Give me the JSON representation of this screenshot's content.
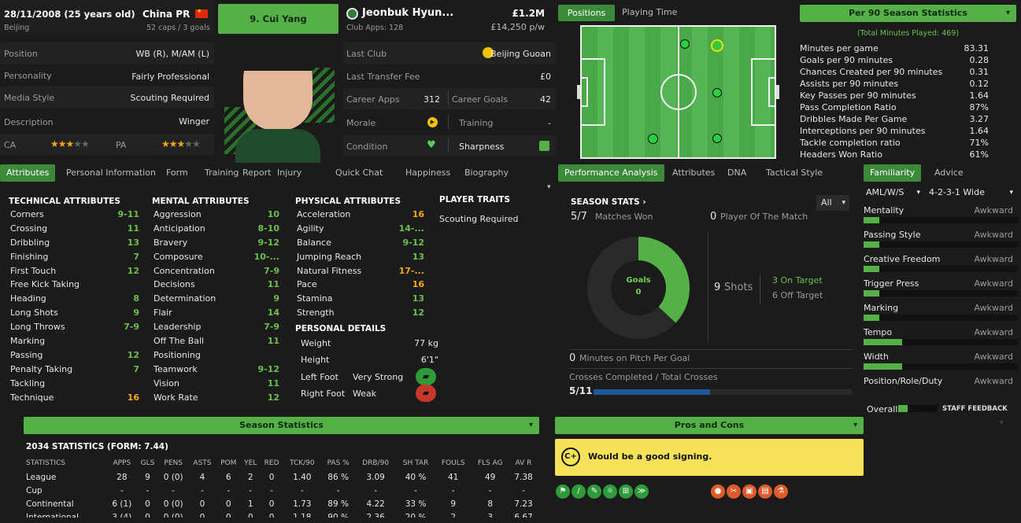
{
  "profile": {
    "dob": "28/11/2008 (25 years old)",
    "nation": "China PR",
    "city": "Beijing",
    "caps": "52 caps / 3 goals",
    "name_button": "9. Cui Yang"
  },
  "club": {
    "name": "Jeonbuk Hyun...",
    "apps": "Club Apps: 128",
    "value": "£1.2M",
    "wage": "£14,250 p/w"
  },
  "info_left": [
    {
      "label": "Position",
      "value": "WB (R), M/AM (L)"
    },
    {
      "label": "Personality",
      "value": "Fairly Professional"
    },
    {
      "label": "Media Style",
      "value": "Scouting Required"
    },
    {
      "label": "Description",
      "value": "Winger"
    }
  ],
  "ratings": {
    "ca_label": "CA",
    "pa_label": "PA",
    "ca_stars": "★★★★★",
    "pa_stars": "★★★★★"
  },
  "info_right": {
    "last_club_label": "Last Club",
    "last_club": "Beijing Guoan",
    "transfer_label": "Last Transfer Fee",
    "transfer": "£0",
    "career_apps_label": "Career Apps",
    "career_apps": "312",
    "career_goals_label": "Career Goals",
    "career_goals": "42",
    "morale_label": "Morale",
    "training_label": "Training",
    "training": "-",
    "condition_label": "Condition",
    "sharpness_label": "Sharpness"
  },
  "pitch_tabs": {
    "positions": "Positions",
    "playing_time": "Playing Time"
  },
  "per90": {
    "title": "Per 90 Season Statistics",
    "sub": "(Total Minutes Played: 469)",
    "rows": [
      {
        "label": "Minutes per game",
        "value": "83.31"
      },
      {
        "label": "Goals per 90 minutes",
        "value": "0.28"
      },
      {
        "label": "Chances Created per 90 minutes",
        "value": "0.31"
      },
      {
        "label": "Assists per 90 minutes",
        "value": "0.12"
      },
      {
        "label": "Key Passes per 90 minutes",
        "value": "1.64"
      },
      {
        "label": "Pass Completion Ratio",
        "value": "87%"
      },
      {
        "label": "Dribbles Made Per Game",
        "value": "3.27"
      },
      {
        "label": "Interceptions per 90 minutes",
        "value": "1.64"
      },
      {
        "label": "Tackle completion ratio",
        "value": "71%"
      },
      {
        "label": "Headers Won Ratio",
        "value": "61%"
      }
    ]
  },
  "tabs_left": [
    "Attributes",
    "Personal Information",
    "Form",
    "Training",
    "Report",
    "Injury",
    "Quick Chat",
    "Happiness",
    "Biography"
  ],
  "tabs_mid": [
    "Performance Analysis",
    "Attributes",
    "DNA",
    "Tactical Style"
  ],
  "tabs_right": [
    "Familiarity",
    "Advice"
  ],
  "technical": {
    "title": "TECHNICAL ATTRIBUTES",
    "rows": [
      {
        "n": "Corners",
        "v": "9-11",
        "c": "green"
      },
      {
        "n": "Crossing",
        "v": "11",
        "c": "green"
      },
      {
        "n": "Dribbling",
        "v": "13",
        "c": "green"
      },
      {
        "n": "Finishing",
        "v": "7",
        "c": "green"
      },
      {
        "n": "First Touch",
        "v": "12",
        "c": "green"
      },
      {
        "n": "Free Kick Taking",
        "v": "",
        "c": "green"
      },
      {
        "n": "Heading",
        "v": "8",
        "c": "green"
      },
      {
        "n": "Long Shots",
        "v": "9",
        "c": "green"
      },
      {
        "n": "Long Throws",
        "v": "7-9",
        "c": "green"
      },
      {
        "n": "Marking",
        "v": "",
        "c": "green"
      },
      {
        "n": "Passing",
        "v": "12",
        "c": "green"
      },
      {
        "n": "Penalty Taking",
        "v": "7",
        "c": "green"
      },
      {
        "n": "Tackling",
        "v": "",
        "c": "green"
      },
      {
        "n": "Technique",
        "v": "16",
        "c": "orange"
      }
    ]
  },
  "mental": {
    "title": "MENTAL ATTRIBUTES",
    "rows": [
      {
        "n": "Aggression",
        "v": "10",
        "c": "green"
      },
      {
        "n": "Anticipation",
        "v": "8-10",
        "c": "green"
      },
      {
        "n": "Bravery",
        "v": "9-12",
        "c": "green"
      },
      {
        "n": "Composure",
        "v": "10-...",
        "c": "green"
      },
      {
        "n": "Concentration",
        "v": "7-9",
        "c": "green"
      },
      {
        "n": "Decisions",
        "v": "11",
        "c": "green"
      },
      {
        "n": "Determination",
        "v": "9",
        "c": "green"
      },
      {
        "n": "Flair",
        "v": "14",
        "c": "green"
      },
      {
        "n": "Leadership",
        "v": "7-9",
        "c": "green"
      },
      {
        "n": "Off The Ball",
        "v": "11",
        "c": "green"
      },
      {
        "n": "Positioning",
        "v": "",
        "c": "green"
      },
      {
        "n": "Teamwork",
        "v": "9-12",
        "c": "green"
      },
      {
        "n": "Vision",
        "v": "11",
        "c": "green"
      },
      {
        "n": "Work Rate",
        "v": "12",
        "c": "green"
      }
    ]
  },
  "physical": {
    "title": "PHYSICAL ATTRIBUTES",
    "rows": [
      {
        "n": "Acceleration",
        "v": "16",
        "c": "orange"
      },
      {
        "n": "Agility",
        "v": "14-...",
        "c": "green"
      },
      {
        "n": "Balance",
        "v": "9-12",
        "c": "green"
      },
      {
        "n": "Jumping Reach",
        "v": "13",
        "c": "green"
      },
      {
        "n": "Natural Fitness",
        "v": "17-...",
        "c": "orange"
      },
      {
        "n": "Pace",
        "v": "16",
        "c": "orange"
      },
      {
        "n": "Stamina",
        "v": "13",
        "c": "green"
      },
      {
        "n": "Strength",
        "v": "12",
        "c": "green"
      }
    ]
  },
  "personal": {
    "title": "PERSONAL DETAILS",
    "weight_l": "Weight",
    "weight": "77 kg",
    "height_l": "Height",
    "height": "6'1\"",
    "left_l": "Left Foot",
    "left": "Very Strong",
    "right_l": "Right Foot",
    "right": "Weak"
  },
  "traits": {
    "title": "PLAYER TRAITS",
    "text": "Scouting Required"
  },
  "season": {
    "title": "SEASON STATS",
    "filter": "All",
    "matches_won_v": "5/7",
    "matches_won_l": "Matches Won",
    "potm_v": "0",
    "potm_l": "Player Of The Match",
    "goals_l": "Goals",
    "goals_v": "0",
    "shots_v": "9",
    "shots_l": "Shots",
    "on_target": "3  On Target",
    "off_target": "6  Off Target",
    "mpg_v": "0",
    "mpg_l": "Minutes on Pitch Per Goal",
    "crosses_l": "Crosses Completed / Total Crosses",
    "crosses_v": "5/11",
    "cross_ratio": 0.45
  },
  "familiarity": {
    "role_select": "AML/W/S",
    "formation_select": "4-2-3-1 Wide",
    "rows": [
      {
        "label": "Mentality",
        "status": "Awkward",
        "level": 0.1
      },
      {
        "label": "Passing Style",
        "status": "Awkward",
        "level": 0.1
      },
      {
        "label": "Creative Freedom",
        "status": "Awkward",
        "level": 0.1
      },
      {
        "label": "Trigger Press",
        "status": "Awkward",
        "level": 0.1
      },
      {
        "label": "Marking",
        "status": "Awkward",
        "level": 0.1
      },
      {
        "label": "Tempo",
        "status": "Awkward",
        "level": 0.25
      },
      {
        "label": "Width",
        "status": "Awkward",
        "level": 0.25
      },
      {
        "label": "Position/Role/Duty",
        "status": "Awkward",
        "level": 0
      }
    ],
    "overall_l": "Overall",
    "staff_feedback": "STAFF FEEDBACK"
  },
  "season_stats": {
    "title": "Season Statistics",
    "head": "2034 STATISTICS (FORM: 7.44)",
    "cols": [
      "STATISTICS",
      "APPS",
      "GLS",
      "PENS",
      "ASTS",
      "POM",
      "YEL",
      "RED",
      "TCK/90",
      "PAS %",
      "DRB/90",
      "SH TAR",
      "FOULS",
      "FLS AG",
      "AV R"
    ],
    "rows": [
      [
        "League",
        "28",
        "9",
        "0 (0)",
        "4",
        "6",
        "2",
        "0",
        "1.40",
        "86 %",
        "3.09",
        "40 %",
        "41",
        "49",
        "7.38"
      ],
      [
        "Cup",
        "-",
        "-",
        "-",
        "-",
        "-",
        "-",
        "-",
        "-",
        "-",
        "-",
        "-",
        "-",
        "-",
        "-"
      ],
      [
        "Continental",
        "6 (1)",
        "0",
        "0 (0)",
        "0",
        "0",
        "1",
        "0",
        "1.73",
        "89 %",
        "4.22",
        "33 %",
        "9",
        "8",
        "7.23"
      ],
      [
        "International",
        "3 (4)",
        "0",
        "0 (0)",
        "0",
        "0",
        "0",
        "0",
        "1.18",
        "90 %",
        "2.36",
        "20 %",
        "2",
        "3",
        "6.67"
      ]
    ]
  },
  "pros": {
    "title": "Pros and Cons",
    "grade": "C+",
    "text": "Would be a good signing."
  },
  "colors": {
    "accent": "#55b048",
    "yellow": "#f5e15a",
    "orange_icon": "#e05a2a"
  }
}
